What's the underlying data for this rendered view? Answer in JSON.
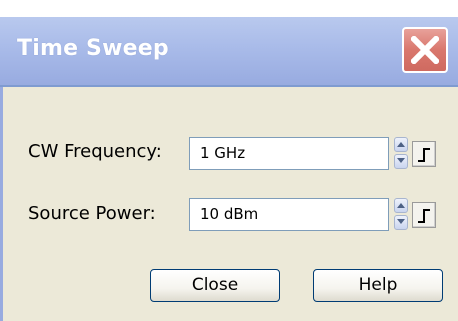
{
  "window": {
    "title": "Time Sweep"
  },
  "titlebar": {
    "close_icon": "close-icon",
    "close_color": "#d9776d",
    "title_gradient": "#a9bbe9"
  },
  "fields": [
    {
      "label": "CW Frequency:",
      "value": "1 GHz"
    },
    {
      "label": "Source Power:",
      "value": "10 dBm"
    }
  ],
  "icons": {
    "spin_up": "chevron-up-icon",
    "spin_down": "chevron-down-icon",
    "step": "step-icon"
  },
  "buttons": {
    "close_label": "Close",
    "help_label": "Help"
  }
}
